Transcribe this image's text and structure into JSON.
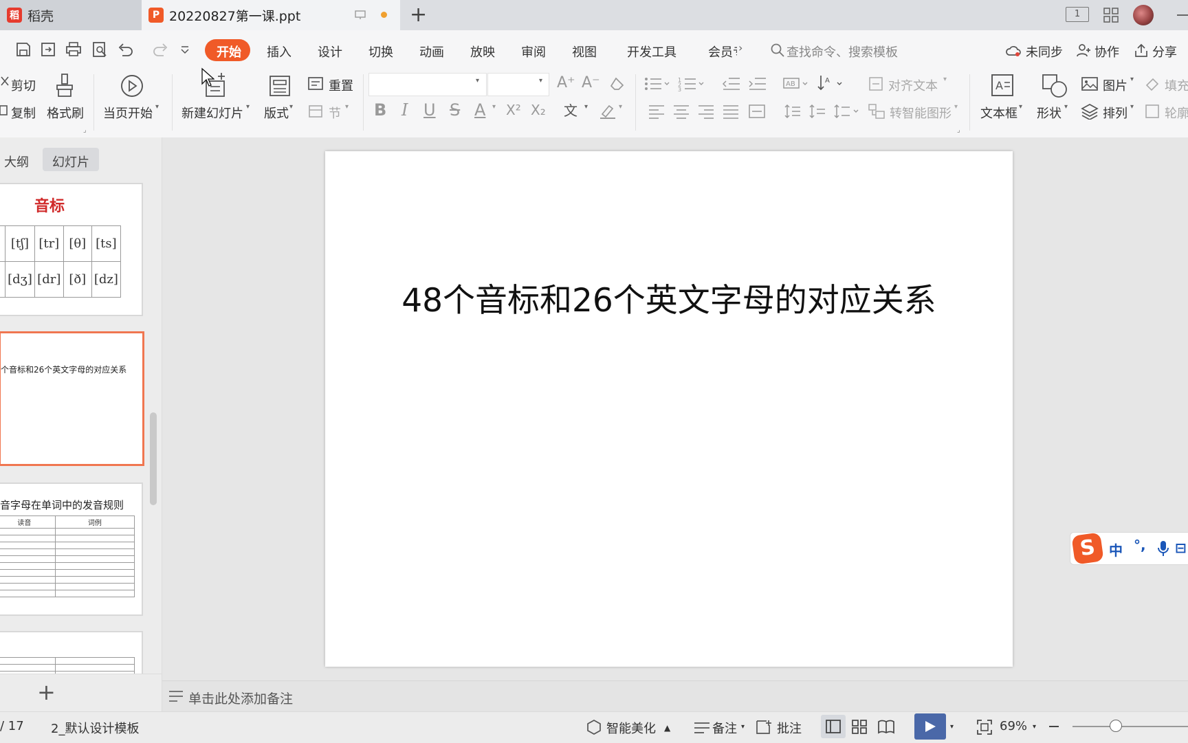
{
  "titlebar": {
    "tab1_label": "稻壳",
    "tab2_label": "20220827第一课.ppt",
    "new_tab": "+",
    "unsaved_dot_color": "#f0a030",
    "page_indicator": "1"
  },
  "ribbon": {
    "tabs": [
      "开始",
      "插入",
      "设计",
      "切换",
      "动画",
      "放映",
      "审阅",
      "视图",
      "开发工具",
      "会员专"
    ],
    "active_tab_color": "#f05a28",
    "search_placeholder": "查找命令、搜索模板",
    "sync_label": "未同步",
    "collab_label": "协作",
    "share_label": "分享",
    "cut": "剪切",
    "copy": "复制",
    "format_painter": "格式刷",
    "play_from_current": "当页开始",
    "new_slide": "新建幻灯片",
    "layout": "版式",
    "reset": "重置",
    "section": "节",
    "align_text": "对齐文本",
    "smartart": "转智能图形",
    "textbox": "文本框",
    "shape": "形状",
    "picture": "图片",
    "arrange": "排列",
    "fill": "填充",
    "outline": "轮廓",
    "bold": "B",
    "italic": "I",
    "underline": "U",
    "strike": "S",
    "font_color": "A",
    "superscript": "X²",
    "subscript": "X₂"
  },
  "panel": {
    "tab_outline": "大纲",
    "tab_slides": "幻灯片",
    "add_slide": "+",
    "slide1": {
      "title": "音标",
      "row1": [
        "[tʃ]",
        "[tr]",
        "[θ]",
        "[ts]"
      ],
      "row2": [
        "[dʒ]",
        "[dr]",
        "[ð]",
        "[dz]"
      ]
    },
    "slide2_title": "个音标和26个英文字母的对应关系",
    "slide3": {
      "title": "音字母在单词中的发音规则",
      "headers": [
        "读音",
        "词例"
      ]
    }
  },
  "slide": {
    "title": "48个音标和26个英文字母的对应关系"
  },
  "notes": {
    "placeholder": "单击此处添加备注"
  },
  "status": {
    "page": "/ 17",
    "template": "2_默认设计模板",
    "beautify": "智能美化",
    "notes": "备注",
    "comments": "批注",
    "zoom": "69%"
  },
  "ime": {
    "label": "中"
  }
}
